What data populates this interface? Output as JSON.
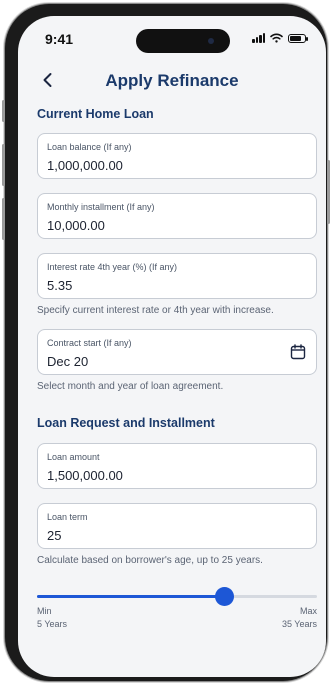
{
  "status": {
    "time": "9:41"
  },
  "header": {
    "title": "Apply Refinance"
  },
  "current_loan": {
    "heading": "Current Home Loan",
    "balance": {
      "label": "Loan balance (If any)",
      "value": "1,000,000.00"
    },
    "installment": {
      "label": "Monthly installment (If any)",
      "value": "10,000.00"
    },
    "interest": {
      "label": "Interest rate 4th year (%) (If any)",
      "value": "5.35",
      "hint": "Specify current interest rate or 4th year with increase."
    },
    "contract": {
      "label": "Contract start (If any)",
      "value": "Dec 20",
      "hint": "Select month and year of loan agreement."
    }
  },
  "loan_request": {
    "heading": "Loan Request and Installment",
    "amount": {
      "label": "Loan amount",
      "value": "1,500,000.00"
    },
    "term": {
      "label": "Loan term",
      "value": "25",
      "hint": "Calculate based on borrower's age, up to 25 years."
    }
  },
  "slider": {
    "min_label": "Min",
    "min_value": "5 Years",
    "max_label": "Max",
    "max_value": "35 Years",
    "min": 5,
    "max": 35,
    "current": 25
  },
  "colors": {
    "accent": "#1d57d6",
    "title": "#1b3a6b"
  },
  "icons": {
    "back": "chevron-left-icon",
    "calendar": "calendar-icon"
  }
}
